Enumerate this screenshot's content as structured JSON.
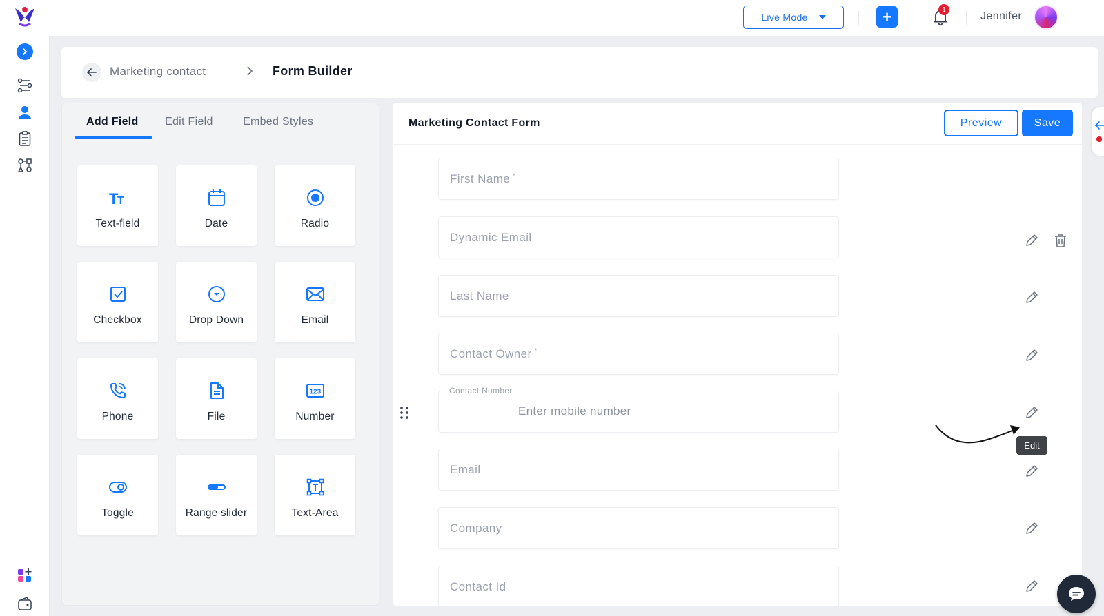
{
  "topbar": {
    "mode_label": "Live Mode",
    "notification_count": "1",
    "user_name": "Jennifer"
  },
  "sidebar": {
    "items": [
      {
        "icon": "workflow-icon"
      },
      {
        "icon": "contacts-icon"
      },
      {
        "icon": "clipboard-icon"
      },
      {
        "icon": "integrations-icon"
      },
      {
        "icon": "apps-add-icon"
      },
      {
        "icon": "wallet-icon"
      }
    ]
  },
  "breadcrumb": {
    "parent": "Marketing contact",
    "current": "Form Builder"
  },
  "left_panel": {
    "tabs": [
      "Add Field",
      "Edit Field",
      "Embed Styles"
    ],
    "active_tab": "Add Field",
    "fields": [
      {
        "label": "Text-field",
        "icon": "text-field-icon"
      },
      {
        "label": "Date",
        "icon": "calendar-icon"
      },
      {
        "label": "Radio",
        "icon": "radio-icon"
      },
      {
        "label": "Checkbox",
        "icon": "checkbox-icon"
      },
      {
        "label": "Drop Down",
        "icon": "dropdown-icon"
      },
      {
        "label": "Email",
        "icon": "mail-icon"
      },
      {
        "label": "Phone",
        "icon": "phone-icon"
      },
      {
        "label": "File",
        "icon": "file-icon"
      },
      {
        "label": "Number",
        "icon": "number-icon"
      },
      {
        "label": "Toggle",
        "icon": "toggle-icon"
      },
      {
        "label": "Range slider",
        "icon": "slider-icon"
      },
      {
        "label": "Text-Area",
        "icon": "text-area-icon"
      }
    ]
  },
  "form": {
    "title": "Marketing Contact Form",
    "preview_label": "Preview",
    "save_label": "Save",
    "fields": [
      {
        "label": "First Name",
        "required_mark": "*"
      },
      {
        "label": "Dynamic Email"
      },
      {
        "label": "Last Name"
      },
      {
        "label": "Contact Owner",
        "required_mark": "*"
      },
      {
        "label": "Contact Number",
        "placeholder": "Enter mobile number"
      },
      {
        "label": "Email"
      },
      {
        "label": "Company"
      },
      {
        "label": "Contact Id"
      }
    ],
    "tooltip": "Edit"
  },
  "colors": {
    "accent": "#1677ff",
    "badge": "#e11d2e"
  }
}
